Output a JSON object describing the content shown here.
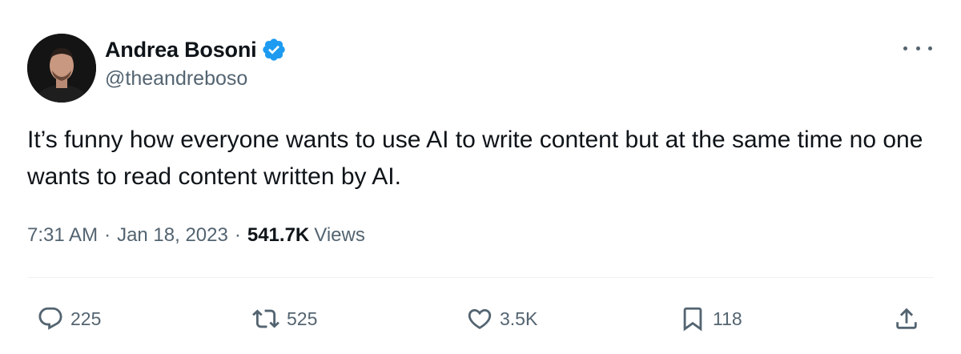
{
  "author": {
    "display_name": "Andrea Bosoni",
    "handle": "@theandreboso",
    "verified": true
  },
  "tweet": {
    "text": "It’s funny how everyone wants to use AI to write content but at the same time no one wants to read content written by AI.",
    "time": "7:31 AM",
    "separator": "·",
    "date": "Jan 18, 2023",
    "views_count": "541.7K",
    "views_label": "Views"
  },
  "actions": {
    "replies": "225",
    "reposts": "525",
    "likes": "3.5K",
    "bookmarks": "118"
  },
  "icons": {
    "verified": "verified-badge-icon",
    "more": "more-options-icon",
    "reply": "reply-icon",
    "repost": "repost-icon",
    "like": "heart-icon",
    "bookmark": "bookmark-icon",
    "share": "share-icon"
  },
  "colors": {
    "text": "#0f1419",
    "secondary": "#536471",
    "verified": "#1d9bf0",
    "divider": "#eff3f4"
  }
}
